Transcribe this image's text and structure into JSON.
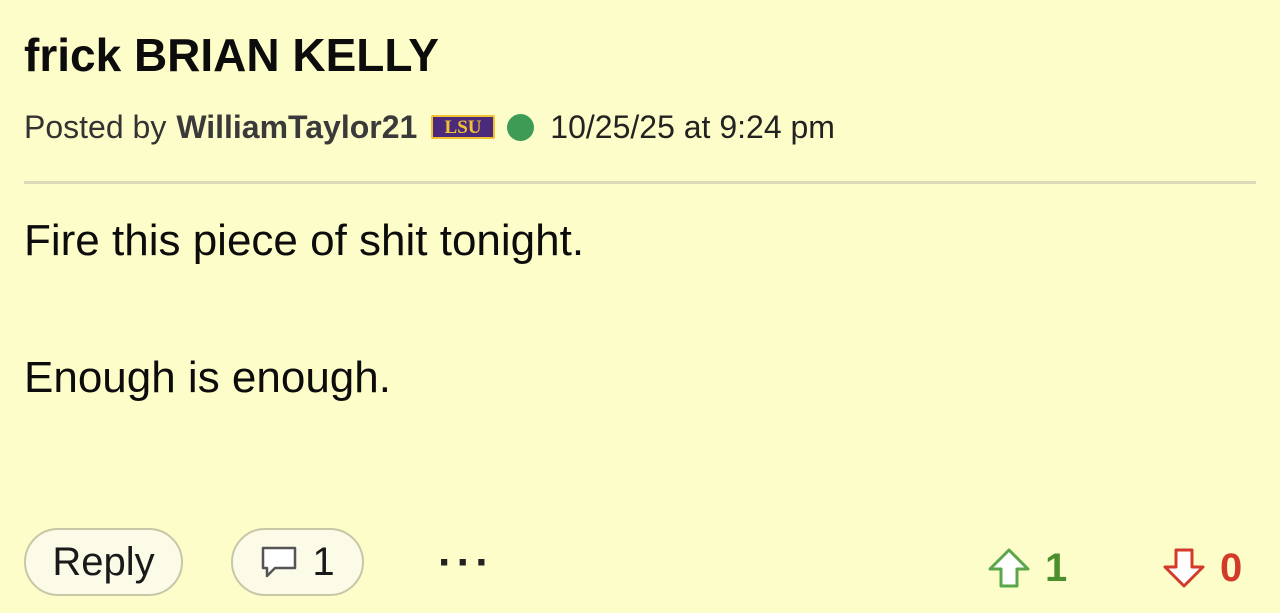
{
  "post": {
    "title": "frick BRIAN KELLY",
    "meta": {
      "prefix": "Posted by",
      "author": "WilliamTaylor21",
      "team_logo": "LSU",
      "online_status": "online",
      "timestamp": "10/25/25 at 9:24 pm"
    },
    "body": [
      "Fire this piece of shit tonight.",
      "Enough is enough."
    ],
    "actions": {
      "reply_label": "Reply",
      "comment_count": "1",
      "more_label": "···",
      "upvotes": "1",
      "downvotes": "0"
    }
  },
  "colors": {
    "background": "#fdfdc9",
    "online_dot": "#3d9b55",
    "upvote": "#4b8f2c",
    "downvote": "#d43a2a",
    "team_purple": "#4b2a7b",
    "team_gold": "#f1c232"
  },
  "icons": {
    "team_logo": "lsu-logo-icon",
    "comment": "speech-bubble-icon",
    "upvote": "arrow-up-icon",
    "downvote": "arrow-down-icon",
    "online": "online-dot-icon"
  }
}
